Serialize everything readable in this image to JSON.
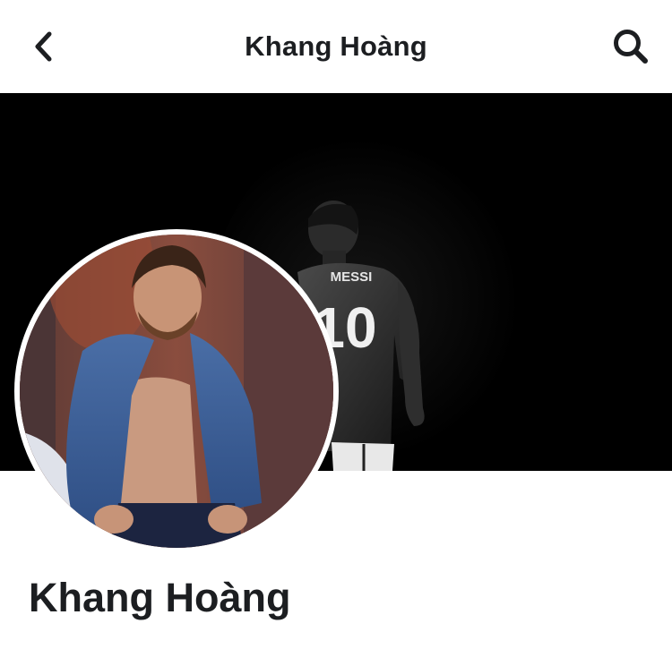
{
  "header": {
    "title": "Khang Hoàng",
    "back_icon": "chevron-left-icon",
    "search_icon": "search-icon"
  },
  "cover": {
    "jersey_name": "MESSI",
    "jersey_number": "10"
  },
  "profile": {
    "name": "Khang Hoàng"
  },
  "colors": {
    "text": "#1c1e21",
    "cover_bg": "#000000",
    "background": "#ffffff"
  }
}
